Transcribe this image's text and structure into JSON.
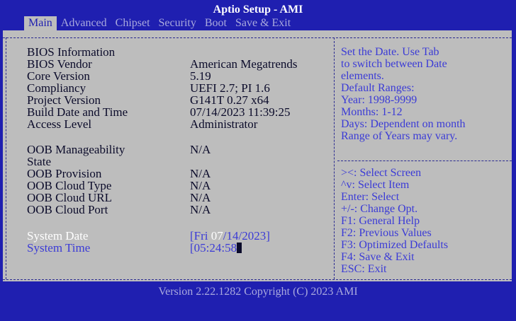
{
  "title": "Aptio Setup - AMI",
  "menu": [
    "Main",
    "Advanced",
    "Chipset",
    "Security",
    "Boot",
    "Save & Exit"
  ],
  "info": [
    {
      "label": "BIOS Information",
      "value": ""
    },
    {
      "label": "BIOS Vendor",
      "value": "American Megatrends"
    },
    {
      "label": "Core Version",
      "value": "5.19"
    },
    {
      "label": "Compliancy",
      "value": "UEFI 2.7; PI 1.6"
    },
    {
      "label": "Project Version",
      "value": "G141T 0.27 x64"
    },
    {
      "label": "Build Date and Time",
      "value": "07/14/2023 11:39:25"
    },
    {
      "label": "Access Level",
      "value": "Administrator"
    }
  ],
  "oob": [
    {
      "label": "OOB Manageability",
      "value": "N/A"
    },
    {
      "label": "State",
      "value": ""
    },
    {
      "label": "OOB Provision",
      "value": "N/A"
    },
    {
      "label": "OOB Cloud Type",
      "value": "N/A"
    },
    {
      "label": "OOB Cloud URL",
      "value": "N/A"
    },
    {
      "label": "OOB Cloud Port",
      "value": "N/A"
    }
  ],
  "system": {
    "date_label": "System Date",
    "date_prefix": "[Fri ",
    "date_month": "07",
    "date_suffix": "/14/2023]",
    "time_label": "System Time",
    "time_value": "[05:24:58"
  },
  "help_top": [
    "Set the Date. Use Tab",
    "to switch between Date",
    "elements.",
    "Default Ranges:",
    "Year: 1998-9999",
    "Months: 1-12",
    "Days: Dependent on month",
    "Range of Years may vary."
  ],
  "keys": [
    "><: Select Screen",
    "^v: Select Item",
    "Enter: Select",
    "+/-: Change Opt.",
    "F1: General Help",
    "F2: Previous Values",
    "F3: Optimized Defaults",
    "F4: Save & Exit",
    "ESC: Exit"
  ],
  "footer": "Version 2.22.1282 Copyright (C) 2023 AMI",
  "colors": {
    "background": "#1f1fb0",
    "panel": "#bdbdbd",
    "help_text": "#3b3bd6",
    "highlight": "#ffffff"
  }
}
